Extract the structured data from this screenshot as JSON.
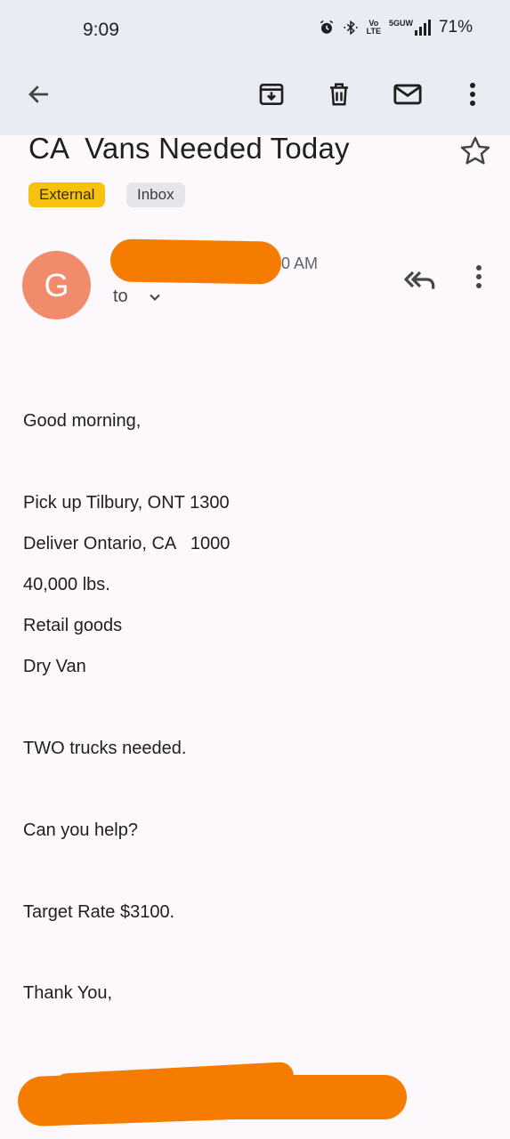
{
  "status_bar": {
    "time": "9:09",
    "network_lines": [
      "Vo",
      "LTE"
    ],
    "network_type": "5GUW",
    "battery": "71%"
  },
  "toolbar": {
    "back_icon": "arrow-left-icon",
    "archive_icon": "archive-icon",
    "delete_icon": "trash-icon",
    "mark_unread_icon": "mail-icon",
    "more_icon": "more-vertical-icon"
  },
  "email": {
    "subject": "CA  Vans Needed Today",
    "labels": [
      "External",
      "Inbox"
    ],
    "sender_initial": "G",
    "time_visible": "0 AM",
    "to_label": "to",
    "body": [
      "Good morning,",
      "Pick up Tilbury, ONT 1300",
      "Deliver Ontario, CA   1000",
      "40,000 lbs.",
      "Retail goods",
      "Dry Van",
      "TWO trucks needed.",
      "Can you help?",
      "Target Rate $3100.",
      "Thank You,"
    ]
  },
  "colors": {
    "accent_orange": "#f57c00",
    "external_chip": "#f6c20f",
    "avatar": "#f28b6b",
    "toolbar_bg": "#e9ecf3"
  }
}
